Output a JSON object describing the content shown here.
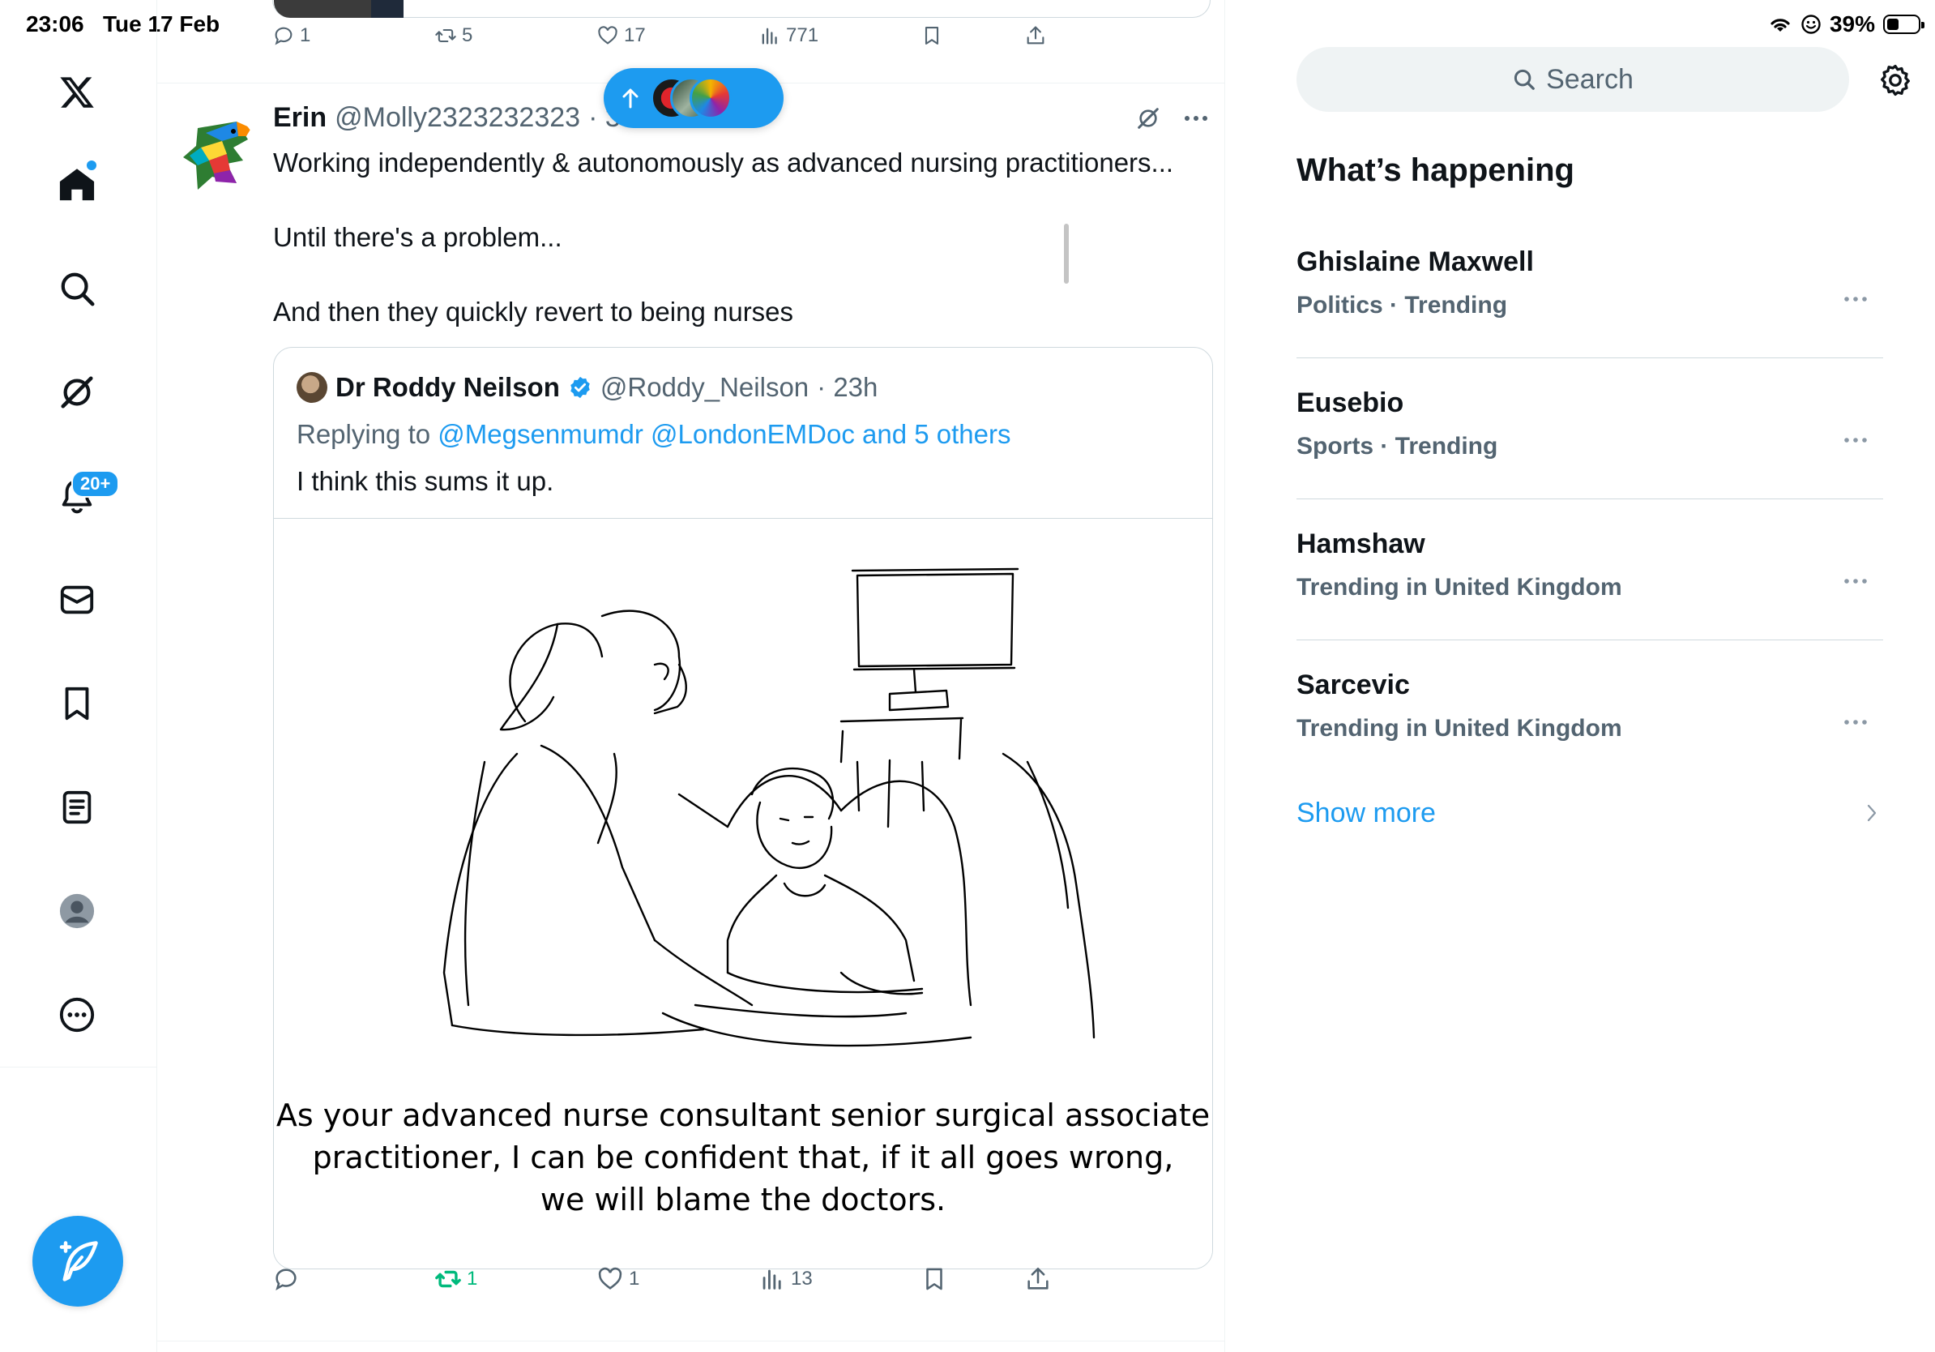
{
  "status_bar": {
    "time": "23:06",
    "date": "Tue 17 Feb",
    "battery": "39%"
  },
  "sidebar": {
    "items": [
      {
        "name": "x-logo"
      },
      {
        "name": "home"
      },
      {
        "name": "explore"
      },
      {
        "name": "grok"
      },
      {
        "name": "notifications",
        "badge": "20+"
      },
      {
        "name": "messages"
      },
      {
        "name": "bookmarks"
      },
      {
        "name": "lists"
      },
      {
        "name": "profile"
      },
      {
        "name": "more"
      }
    ]
  },
  "previous_tweet": {
    "replies": "1",
    "reposts": "5",
    "likes": "17",
    "views": "771"
  },
  "tweet": {
    "author_name": "Erin",
    "author_handle": "@Molly2323232323",
    "time_fragment": "· 30m",
    "lines": [
      "Working independently & autonomously as advanced nursing practitioners...",
      "",
      "Until there's a problem...",
      "",
      "And then they quickly revert to being nurses"
    ],
    "quote": {
      "author_name": "Dr Roddy Neilson",
      "author_handle": "@Roddy_Neilson",
      "time": "· 23h",
      "reply_prefix": "Replying to",
      "reply_mentions": "@Megsenmumdr @LondonEMDoc and 5 others",
      "text": "I think this sums it up.",
      "image_caption": [
        "As your advanced nurse consultant senior surgical associate",
        "practitioner, I can be confident that, if it all goes wrong,",
        "we will blame the doctors."
      ]
    },
    "stats": {
      "replies": "",
      "reposts": "1",
      "likes": "1",
      "views": "13"
    }
  },
  "right_panel": {
    "search_placeholder": "Search",
    "section_title": "What’s happening",
    "trends": [
      {
        "name": "Ghislaine Maxwell",
        "meta": "Politics · Trending"
      },
      {
        "name": "Eusebio",
        "meta": "Sports · Trending"
      },
      {
        "name": "Hamshaw",
        "meta": "Trending in United Kingdom"
      },
      {
        "name": "Sarcevic",
        "meta": "Trending in United Kingdom"
      }
    ],
    "show_more": "Show more"
  },
  "colors": {
    "accent": "#1d9bf0",
    "repost_active": "#00ba7c",
    "muted": "#536471"
  }
}
